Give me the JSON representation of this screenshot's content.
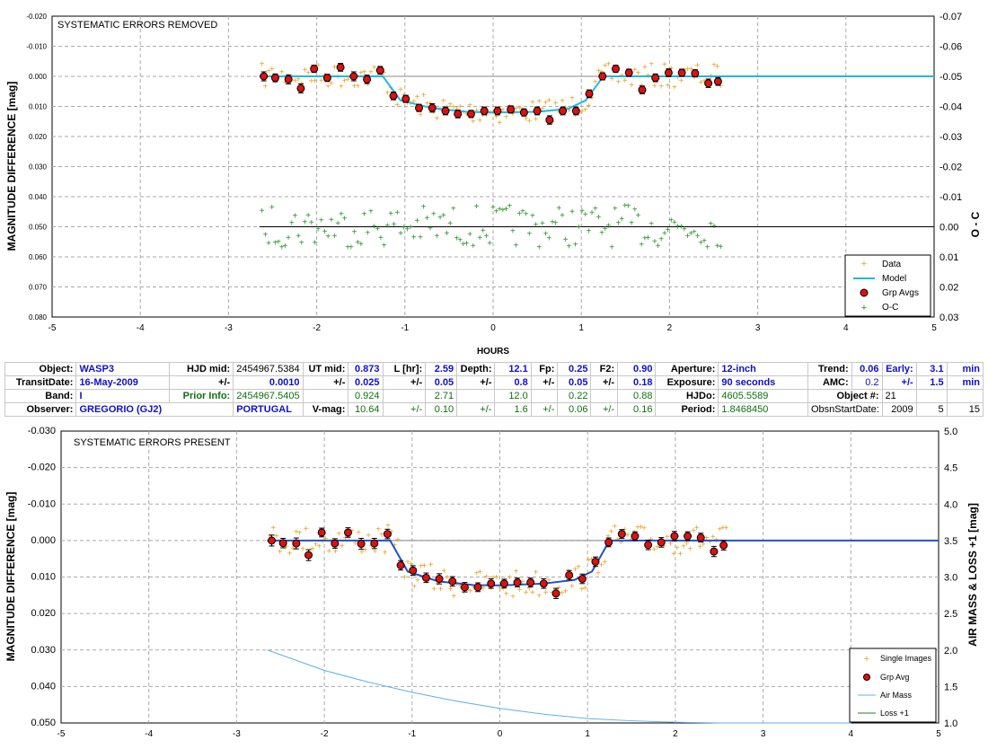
{
  "chart_data": [
    {
      "type": "scatter",
      "title": "SYSTEMATIC ERRORS REMOVED",
      "xlabel": "HOURS",
      "ylabel": "MAGNITUDE DIFFERENCE [mag]",
      "y2label": "O - C",
      "xlim": [
        -5,
        5
      ],
      "ylim": [
        0.08,
        -0.02
      ],
      "y2lim": [
        0.03,
        -0.07
      ],
      "x_ticks": [
        "-5",
        "-4",
        "-3",
        "-2",
        "-1",
        "0",
        "1",
        "2",
        "3",
        "4",
        "5"
      ],
      "y_ticks": [
        "-0.020",
        "-0.010",
        "0.000",
        "0.010",
        "0.020",
        "0.030",
        "0.040",
        "0.050",
        "0.060",
        "0.070",
        "0.080"
      ],
      "y2_ticks": [
        "-0.07",
        "-0.06",
        "-0.05",
        "-0.04",
        "-0.03",
        "-0.02",
        "-0.01",
        "0.00",
        "0.01",
        "0.02",
        "0.03"
      ],
      "grid": true,
      "legend_position": "bottom-right",
      "legend": [
        "Data",
        "Model",
        "Grp Avgs",
        "O-C"
      ],
      "colors": {
        "data": "#e8a020",
        "model": "#20b8e0",
        "grp": "#e01010",
        "oc": "#209020"
      },
      "model": {
        "x": [
          -2.65,
          -1.25,
          -1.05,
          -0.7,
          -0.3,
          0,
          0.5,
          0.85,
          1.05,
          1.25,
          5.0
        ],
        "y": [
          0.0,
          0.0,
          0.008,
          0.0105,
          0.0118,
          0.012,
          0.0118,
          0.0108,
          0.008,
          0.0,
          0.0
        ]
      },
      "group_averages": {
        "x": [
          -2.6,
          -2.47,
          -2.32,
          -2.18,
          -2.03,
          -1.88,
          -1.73,
          -1.58,
          -1.43,
          -1.28,
          -1.13,
          -0.99,
          -0.84,
          -0.69,
          -0.54,
          -0.4,
          -0.25,
          -0.1,
          0.05,
          0.2,
          0.35,
          0.5,
          0.64,
          0.79,
          0.94,
          1.09,
          1.24,
          1.39,
          1.54,
          1.69,
          1.84,
          1.99,
          2.14,
          2.29,
          2.44,
          2.55
        ],
        "y": [
          0.0,
          0.0005,
          0.001,
          0.004,
          -0.0025,
          0.0005,
          -0.003,
          0.0,
          0.001,
          -0.002,
          0.0065,
          0.0075,
          0.0105,
          0.0105,
          0.0115,
          0.0125,
          0.0125,
          0.0115,
          0.0115,
          0.011,
          0.012,
          0.0115,
          0.0145,
          0.0115,
          0.0115,
          0.0058,
          -0.0,
          -0.0025,
          -0.0012,
          0.0045,
          0.0005,
          -0.0012,
          -0.0012,
          -0.001,
          0.0023,
          0.0017
        ],
        "err": [
          0.0015,
          0.0013,
          0.0015,
          0.0015,
          0.0012,
          0.0012,
          0.0013,
          0.0015,
          0.0014,
          0.0013,
          0.0013,
          0.0012,
          0.0012,
          0.0014,
          0.0013,
          0.0013,
          0.0012,
          0.0013,
          0.0013,
          0.0012,
          0.0012,
          0.0013,
          0.0014,
          0.0013,
          0.0013,
          0.0013,
          0.0012,
          0.0012,
          0.0012,
          0.0013,
          0.0013,
          0.0013,
          0.0012,
          0.0012,
          0.0014,
          0.0013
        ]
      },
      "oc_baseline_y2": 0.0
    },
    {
      "type": "scatter",
      "title": "SYSTEMATIC ERRORS PRESENT",
      "xlabel": "",
      "ylabel": "MAGNITUDE DIFFERENCE [mag]",
      "y2label": "AIR MASS & LOSS +1 [mag]",
      "xlim": [
        -5,
        5
      ],
      "ylim": [
        0.05,
        -0.03
      ],
      "y2lim": [
        1.0,
        5.0
      ],
      "x_ticks": [
        "-5",
        "-4",
        "-3",
        "-2",
        "-1",
        "0",
        "1",
        "2",
        "3",
        "4",
        "5"
      ],
      "y_ticks": [
        "-0.030",
        "-0.020",
        "-0.010",
        "0.000",
        "0.010",
        "0.020",
        "0.030",
        "0.040",
        "0.050"
      ],
      "y2_ticks": [
        "5.0",
        "4.5",
        "4.0",
        "3.5",
        "3.0",
        "2.5",
        "2.0",
        "1.5",
        "1.0"
      ],
      "grid": true,
      "legend_position": "bottom-right",
      "legend": [
        "Single Images",
        "Grp Avg",
        "Air Mass",
        "Loss +1"
      ],
      "colors": {
        "data": "#e8a020",
        "model": "#2050d0",
        "grp": "#e01010",
        "airmass": "#60b0e8",
        "loss": "#208020"
      },
      "model": {
        "x": [
          -2.65,
          -1.25,
          -1.05,
          -0.7,
          -0.3,
          0,
          0.5,
          0.85,
          1.05,
          1.25,
          5.0
        ],
        "y": [
          0.0,
          0.0,
          0.0085,
          0.0112,
          0.0122,
          0.0123,
          0.0118,
          0.0108,
          0.0085,
          0.0,
          0.0
        ]
      },
      "group_averages": {
        "x": [
          -2.6,
          -2.47,
          -2.32,
          -2.18,
          -2.03,
          -1.88,
          -1.73,
          -1.58,
          -1.43,
          -1.28,
          -1.13,
          -0.99,
          -0.84,
          -0.69,
          -0.54,
          -0.4,
          -0.25,
          -0.1,
          0.05,
          0.2,
          0.35,
          0.5,
          0.64,
          0.79,
          0.94,
          1.09,
          1.24,
          1.39,
          1.54,
          1.69,
          1.84,
          1.99,
          2.14,
          2.29,
          2.44,
          2.55
        ],
        "y": [
          0.0,
          0.0007,
          0.0008,
          0.004,
          -0.0022,
          0.0008,
          -0.0022,
          0.0009,
          0.0008,
          -0.0018,
          0.0068,
          0.0082,
          0.0102,
          0.0105,
          0.0112,
          0.0128,
          0.0128,
          0.0118,
          0.0118,
          0.0115,
          0.0115,
          0.0118,
          0.0145,
          0.0095,
          0.0105,
          0.0058,
          0.0005,
          -0.0018,
          -0.0012,
          0.0012,
          0.0005,
          -0.0012,
          -0.0012,
          -0.0008,
          0.003,
          0.0013
        ],
        "err": [
          0.0015,
          0.0013,
          0.0015,
          0.0015,
          0.0012,
          0.0013,
          0.0013,
          0.0015,
          0.0014,
          0.0013,
          0.0013,
          0.0013,
          0.0013,
          0.0014,
          0.0013,
          0.0013,
          0.0012,
          0.0013,
          0.0012,
          0.0012,
          0.0012,
          0.0013,
          0.0014,
          0.0013,
          0.0013,
          0.0013,
          0.0012,
          0.0012,
          0.0012,
          0.0013,
          0.0013,
          0.0013,
          0.0012,
          0.0012,
          0.0014,
          0.0013
        ]
      },
      "airmass": {
        "x": [
          -2.65,
          -2.0,
          -1.5,
          -1.0,
          -0.5,
          0.0,
          0.5,
          1.0,
          1.5,
          2.0,
          2.5,
          3.0,
          3.5,
          4.0
        ],
        "y": [
          2.0,
          1.72,
          1.56,
          1.42,
          1.3,
          1.2,
          1.12,
          1.06,
          1.03,
          1.01,
          1.0,
          1.0,
          1.0,
          1.0
        ]
      }
    }
  ],
  "info_table": {
    "row1": {
      "object_label": "Object:",
      "object": "WASP3",
      "hjd_mid_label": "HJD mid:",
      "hjd_mid": "2454967.5384",
      "ut_mid_label": "UT mid:",
      "ut_mid": "0.873",
      "l_hr_label": "L [hr]:",
      "l_hr": "2.59",
      "depth_label": "Depth:",
      "depth": "12.1",
      "fp_label": "Fp:",
      "fp": "0.25",
      "f2_label": "F2:",
      "f2": "0.90",
      "aperture_label": "Aperture:",
      "aperture": "12-inch",
      "trend_label": "Trend:",
      "trend": "0.06",
      "early_label": "Early:",
      "early": "3.1",
      "min1": "min"
    },
    "row2": {
      "transit_date_label": "TransitDate:",
      "transit_date": "16-May-2009",
      "pm1": "+/-",
      "hjd_err": "0.0010",
      "pm2": "+/-",
      "ut_err": "0.025",
      "pm3": "+/-",
      "l_err": "0.05",
      "pm4": "+/-",
      "depth_err": "0.8",
      "pm5": "+/-",
      "fp_err": "0.05",
      "pm6": "+/-",
      "f2_err": "0.18",
      "exposure_label": "Exposure:",
      "exposure": "90 seconds",
      "amc_label": "AMC:",
      "amc": "0.2",
      "pm7": "+/-",
      "early_err": "1.5",
      "min2": "min"
    },
    "row3": {
      "band_label": "Band:",
      "band": "I",
      "prior_info_label": "Prior Info:",
      "prior_hjd": "2454967.5405",
      "prior_ut": "0.924",
      "prior_l": "2.71",
      "prior_depth": "12.0",
      "prior_fp": "0.22",
      "prior_f2": "0.88",
      "hjdo_label": "HJDo:",
      "hjdo": "4605.5589",
      "object_num_label": "Object #:",
      "object_num": "21"
    },
    "row4": {
      "observer_label": "Observer:",
      "observer": "GREGORIO (GJ2)",
      "location": "PORTUGAL",
      "vmag_label": "V-mag:",
      "vmag": "10.64",
      "pm1": "+/-",
      "vmag_err": "0.10",
      "pm2": "+/-",
      "depth_err": "1.6",
      "pm3": "+/-",
      "fp_err": "0.06",
      "pm4": "+/-",
      "f2_err": "0.16",
      "period_label": "Period:",
      "period": "1.8468450",
      "obsn_start_label": "ObsnStartDate:",
      "year": "2009",
      "month": "5",
      "day": "15"
    }
  }
}
